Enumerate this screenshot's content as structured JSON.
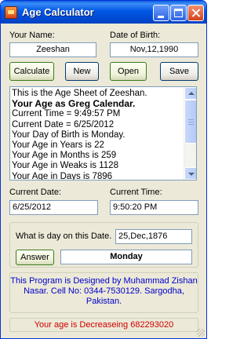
{
  "window": {
    "title": "Age Calculator",
    "icon": "app-icon",
    "controls": [
      "minimize-icon",
      "maximize-icon",
      "close-icon"
    ]
  },
  "inputs": {
    "name_label": "Your Name:",
    "name_value": "Zeeshan",
    "dob_label": "Date of Birth:",
    "dob_value": "Nov,12,1990"
  },
  "toolbar": {
    "calculate": "Calculate",
    "new": "New",
    "open": "Open",
    "save": "Save"
  },
  "memo": {
    "lines": [
      "This is the Age Sheet of Zeeshan.",
      "Your Age as Greg Calendar.",
      "Current Time = 9:49:57 PM",
      "Current Date = 6/25/2012",
      "Your Day of Birth is Monday.",
      "Your Age in Years is 22",
      "Your Age in Months is 259",
      "Your Age in Weaks is 1128",
      "Your Age in Days is 7896"
    ]
  },
  "current": {
    "date_label": "Current Date:",
    "date_value": "6/25/2012",
    "time_label": "Current Time:",
    "time_value": "9:50:20 PM"
  },
  "day_query": {
    "label": "What is day on this Date.",
    "date_value": "25,Dec,1876",
    "answer_button": "Answer",
    "answer_value": "Monday"
  },
  "credit": {
    "text": "This Program is Designed by Muhammad Zishan Nasar. Cell No: 0344-7530129. Sargodha, Pakistan."
  },
  "status": {
    "text": "Your age is Decreaseing 682293020"
  },
  "colors": {
    "titlebar": "#0058e6",
    "window_bg": "#ece9d8",
    "credit_text": "#0000c8",
    "status_text": "#d00000"
  }
}
